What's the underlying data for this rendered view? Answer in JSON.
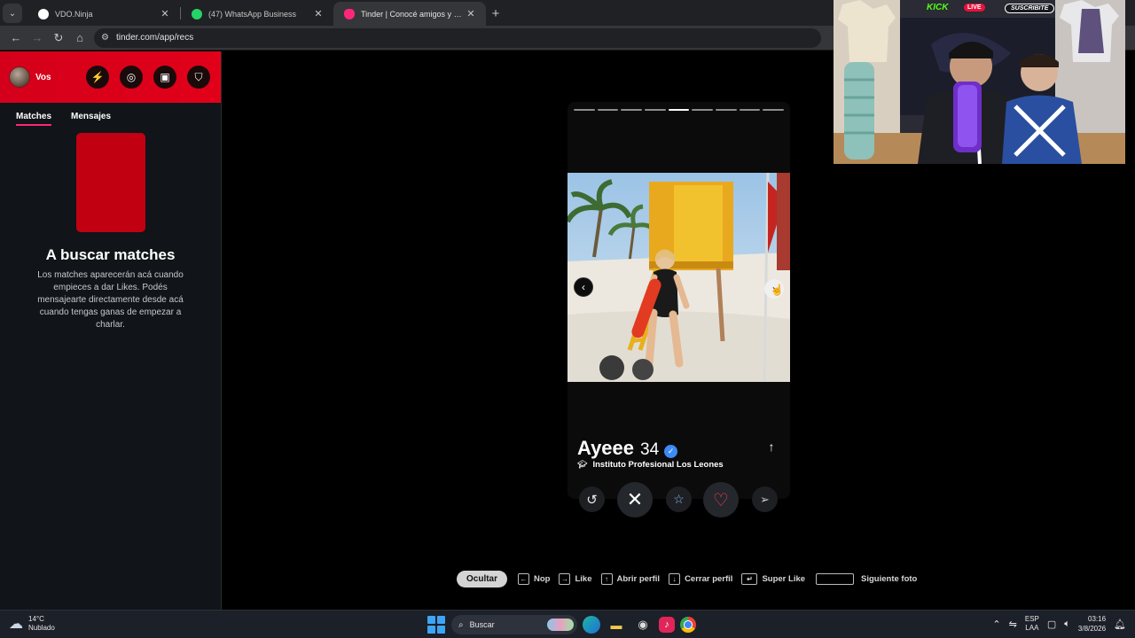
{
  "browser": {
    "tabs": [
      {
        "title": "VDO.Ninja",
        "active": false,
        "favicon_color": "#ffffff"
      },
      {
        "title": "(47) WhatsApp Business",
        "active": false,
        "favicon_color": "#25d366"
      },
      {
        "title": "Tinder | Conocé amigos y gente nueva",
        "active": true,
        "favicon_color": "#fd267a"
      }
    ],
    "url": "tinder.com/app/recs"
  },
  "sidebar": {
    "user_name": "Vos",
    "icons": [
      "boost-icon",
      "explore-icon",
      "briefcase-icon",
      "shield-icon"
    ],
    "tabs": [
      {
        "label": "Matches",
        "active": true
      },
      {
        "label": "Mensajes",
        "active": false
      }
    ],
    "empty_title": "A buscar matches",
    "empty_text": "Los matches aparecerán acá cuando empieces a dar Likes. Podés mensajearte directamente desde acá cuando tengas ganas de empezar a charlar."
  },
  "profile": {
    "name": "Ayeee",
    "age": "34",
    "school": "Instituto Profesional Los Leones",
    "photo_count": 9,
    "active_photo_index": 5
  },
  "hints": {
    "hide": "Ocultar",
    "nope": "Nop",
    "like": "Like",
    "open_profile": "Abrir perfil",
    "close_profile": "Cerrar perfil",
    "super_like": "Super Like",
    "next_photo": "Siguiente foto"
  },
  "stream": {
    "platform": "KICK",
    "live": "LIVE",
    "subscribe": "SUSCRIBITE"
  },
  "taskbar": {
    "temperature": "14°C",
    "weather": "Nublado",
    "search": "Buscar",
    "lang_top": "ESP",
    "lang_bottom": "LAA",
    "time": "03:16",
    "date": "3/8/2026"
  },
  "colors": {
    "tinder_red": "#e10019",
    "accent_pink": "#fd267a",
    "verified_blue": "#3d8af7"
  }
}
